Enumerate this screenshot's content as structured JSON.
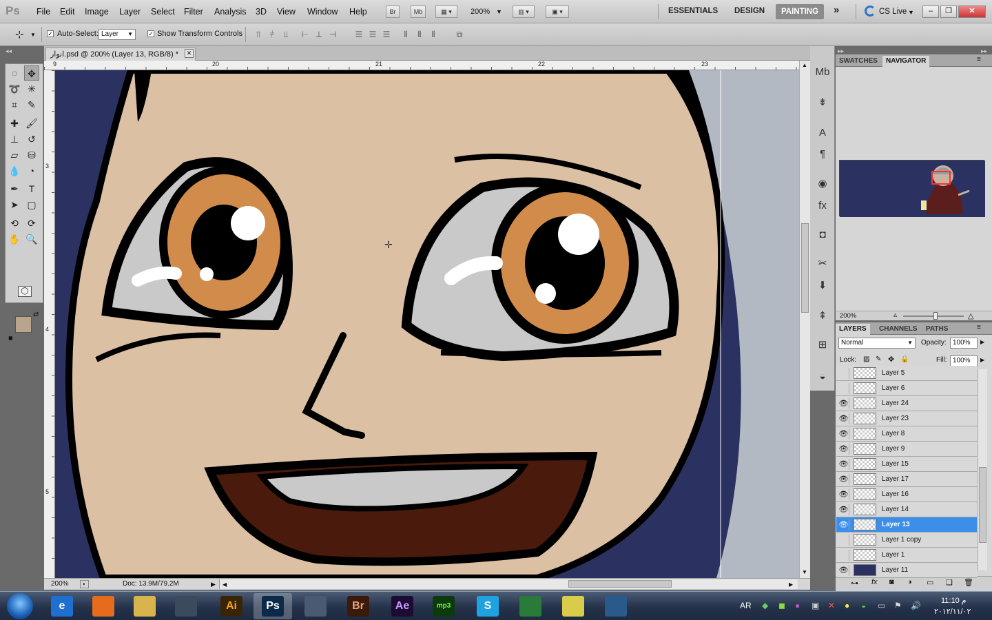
{
  "app": {
    "logo": "Ps"
  },
  "menu": {
    "items": [
      "File",
      "Edit",
      "Image",
      "Layer",
      "Select",
      "Filter",
      "Analysis",
      "3D",
      "View",
      "Window",
      "Help"
    ]
  },
  "appbar": {
    "bridge": "Br",
    "mini_bridge": "Mb",
    "zoom": "200%"
  },
  "workspaces": {
    "essentials": "ESSENTIALS",
    "design": "DESIGN",
    "painting": "PAINTING",
    "more": "»",
    "cslive": "CS Live"
  },
  "options": {
    "auto_select_label": "Auto-Select:",
    "auto_select_value": "Layer",
    "show_transform": "Show Transform Controls"
  },
  "document": {
    "tab_title": "انوار.psd @ 200% (Layer 13, RGB/8) *",
    "ruler_top": [
      "9",
      "20",
      "21",
      "22",
      "23"
    ],
    "ruler_left": [
      "3",
      "4",
      "5"
    ]
  },
  "status": {
    "zoom": "200%",
    "doc_size": "Doc: 13.9M/79.2M"
  },
  "navigator": {
    "tab_swatches": "SWATCHES",
    "tab_navigator": "NAVIGATOR",
    "zoom": "200%"
  },
  "layers_panel": {
    "tab_layers": "LAYERS",
    "tab_channels": "CHANNELS",
    "tab_paths": "PATHS",
    "blend_mode": "Normal",
    "opacity_label": "Opacity:",
    "opacity": "100%",
    "lock_label": "Lock:",
    "fill_label": "Fill:",
    "fill": "100%",
    "layers": [
      {
        "name": "Layer 5",
        "visible": false,
        "selected": false
      },
      {
        "name": "Layer 6",
        "visible": false,
        "selected": false
      },
      {
        "name": "Layer 24",
        "visible": true,
        "selected": false
      },
      {
        "name": "Layer 23",
        "visible": true,
        "selected": false
      },
      {
        "name": "Layer 8",
        "visible": true,
        "selected": false
      },
      {
        "name": "Layer 9",
        "visible": true,
        "selected": false
      },
      {
        "name": "Layer 15",
        "visible": true,
        "selected": false
      },
      {
        "name": "Layer 17",
        "visible": true,
        "selected": false
      },
      {
        "name": "Layer 16",
        "visible": true,
        "selected": false
      },
      {
        "name": "Layer 14",
        "visible": true,
        "selected": false
      },
      {
        "name": "Layer 13",
        "visible": true,
        "selected": true
      },
      {
        "name": "Layer 1 copy",
        "visible": false,
        "selected": false
      },
      {
        "name": "Layer 1",
        "visible": false,
        "selected": false
      },
      {
        "name": "Layer 11",
        "visible": true,
        "selected": false
      }
    ]
  },
  "colors": {
    "foreground": "#b9a58c",
    "background": "#f7e27c",
    "canvas_bg": "#2b3161",
    "skin": "#dcc0a4",
    "iris": "#d18c4c",
    "mouth": "#4a1a0c",
    "selection": "#3d8ee8"
  },
  "taskbar": {
    "apps": [
      {
        "name": "start-orb",
        "label": ""
      },
      {
        "name": "internet-explorer",
        "label": "e"
      },
      {
        "name": "firefox",
        "label": ""
      },
      {
        "name": "explorer",
        "label": ""
      },
      {
        "name": "calligraphy",
        "label": ""
      },
      {
        "name": "illustrator",
        "label": "Ai"
      },
      {
        "name": "photoshop",
        "label": "Ps"
      },
      {
        "name": "media",
        "label": ""
      },
      {
        "name": "bridge",
        "label": "Br"
      },
      {
        "name": "after-effects",
        "label": "Ae"
      },
      {
        "name": "mp3-direct-cut",
        "label": "mp3 cut"
      },
      {
        "name": "skype",
        "label": "S"
      },
      {
        "name": "messenger",
        "label": ""
      },
      {
        "name": "sticky",
        "label": ""
      },
      {
        "name": "image-viewer",
        "label": ""
      }
    ],
    "lang": "AR",
    "time": "11:10 م",
    "date": "٢٠١٢/١١/٠٢"
  }
}
